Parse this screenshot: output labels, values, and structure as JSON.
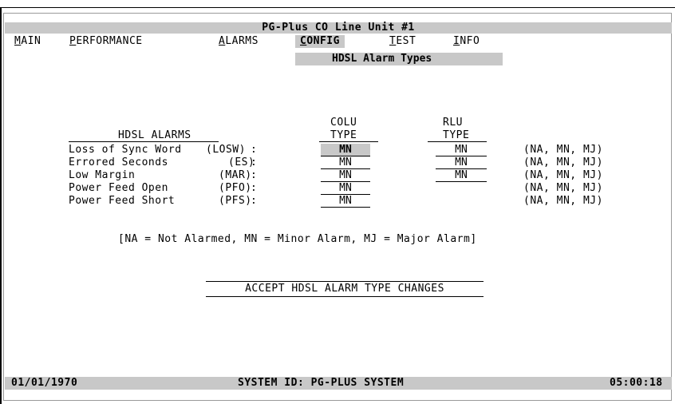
{
  "window": {
    "title": "PG-Plus CO Line Unit #1"
  },
  "menu": {
    "items": [
      {
        "hotkey": "M",
        "rest": "AIN"
      },
      {
        "hotkey": "P",
        "rest": "ERFORMANCE"
      },
      {
        "hotkey": "A",
        "rest": "LARMS"
      },
      {
        "hotkey": "C",
        "rest": "ONFIG"
      },
      {
        "hotkey": "T",
        "rest": "EST"
      },
      {
        "hotkey": "I",
        "rest": "NFO"
      }
    ],
    "submenu_title": "HDSL Alarm Types"
  },
  "table": {
    "col_colu_line1": "COLU",
    "col_colu_line2": "TYPE",
    "col_rlu_line1": "RLU",
    "col_rlu_line2": "TYPE",
    "section_header": "HDSL ALARMS",
    "rows": [
      {
        "label": "Loss of Sync Word",
        "abbr": "(LOSW)",
        "sep": ":",
        "colu": "MN",
        "rlu": "MN",
        "options": "(NA, MN, MJ)"
      },
      {
        "label": "Errored Seconds",
        "abbr": "(ES)",
        "sep": ":",
        "colu": "MN",
        "rlu": "MN",
        "options": "(NA, MN, MJ)"
      },
      {
        "label": "Low Margin",
        "abbr": "(MAR)",
        "sep": ":",
        "colu": "MN",
        "rlu": "MN",
        "options": "(NA, MN, MJ)"
      },
      {
        "label": "Power Feed Open",
        "abbr": "(PFO)",
        "sep": ":",
        "colu": "MN",
        "rlu": null,
        "options": "(NA, MN, MJ)"
      },
      {
        "label": "Power Feed Short",
        "abbr": "(PFS)",
        "sep": ":",
        "colu": "MN",
        "rlu": null,
        "options": "(NA, MN, MJ)"
      }
    ]
  },
  "legend": "[NA = Not Alarmed, MN = Minor Alarm, MJ = Major Alarm]",
  "accept_button": "ACCEPT HDSL ALARM TYPE CHANGES",
  "status": {
    "date": "01/01/1970",
    "system_id": "SYSTEM ID: PG-PLUS SYSTEM",
    "time": "05:00:18"
  }
}
